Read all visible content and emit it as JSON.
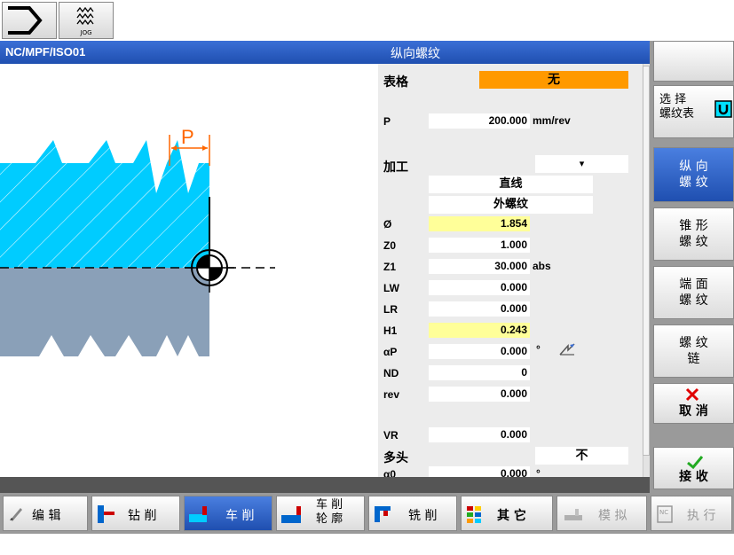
{
  "titlebar": {
    "program_path": "NC/MPF/ISO01",
    "form_title": "纵向螺纹"
  },
  "top": {
    "jog_label": "JOG"
  },
  "graphic": {
    "pitch_label": "P"
  },
  "form": {
    "table_label": "表格",
    "table_value": "无",
    "p_label": "P",
    "p_value": "200.000",
    "p_unit": "mm/rev",
    "machining_label": "加工",
    "machining_dropdown": "▾",
    "mode1": "直线",
    "mode2": "外螺纹",
    "rows": [
      {
        "label": "Ø",
        "value": "1.854",
        "unit": ""
      },
      {
        "label": "Z0",
        "value": "1.000",
        "unit": ""
      },
      {
        "label": "Z1",
        "value": "30.000",
        "unit": "abs"
      },
      {
        "label": "LW",
        "value": "0.000",
        "unit": ""
      },
      {
        "label": "LR",
        "value": "0.000",
        "unit": ""
      },
      {
        "label": "H1",
        "value": "0.243",
        "unit": ""
      },
      {
        "label": "αP",
        "value": "0.000",
        "unit": "°"
      },
      {
        "label": "ND",
        "value": "0",
        "unit": ""
      },
      {
        "label": "rev",
        "value": "0.000",
        "unit": ""
      }
    ],
    "vr_label": "VR",
    "vr_value": "0.000",
    "multi_label": "多头",
    "multi_value": "不",
    "partial_label": "α0",
    "partial_value": "0.000",
    "partial_unit": "°"
  },
  "softkeys": {
    "select_table_line1": "选 择",
    "select_table_line2": "螺纹表",
    "longitudinal_line1": "纵 向",
    "longitudinal_line2": "螺 纹",
    "taper_line1": "锥 形",
    "taper_line2": "螺 纹",
    "face_line1": "端 面",
    "face_line2": "螺 纹",
    "chain_line1": "螺 纹",
    "chain_line2": "链",
    "cancel": "取 消",
    "accept": "接 收"
  },
  "hkeys": {
    "edit": "编 辑",
    "drill": "钻 削",
    "turn": "车 削",
    "contour_line1": "车 削",
    "contour_line2": "轮 廓",
    "mill": "铣 削",
    "other": "其 它",
    "simulate": "模 拟",
    "execute": "执 行"
  },
  "colors": {
    "accent": "#1f4fb0",
    "table_value_bg": "#ff9900",
    "highlight": "#ffff99",
    "part": "#00ccff",
    "material": "#8aa0b8"
  }
}
